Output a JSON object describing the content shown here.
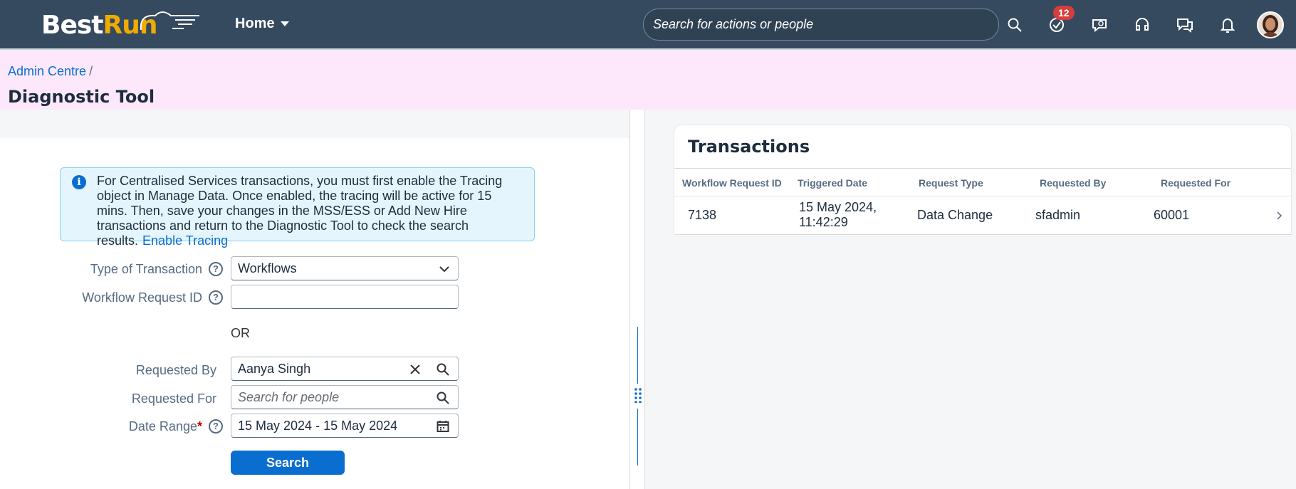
{
  "shell": {
    "logo_part1": "Best",
    "logo_part2": "Run",
    "home_label": "Home",
    "search_placeholder": "Search for actions or people",
    "notification_count": "12",
    "icons": [
      "search-icon",
      "todo-check-icon",
      "chat-icon",
      "headset-support-icon",
      "help-chat-icon",
      "bell-icon",
      "avatar"
    ]
  },
  "header": {
    "breadcrumb": "Admin Centre",
    "breadcrumb_sep": "/",
    "title": "Diagnostic Tool"
  },
  "info": {
    "text": "For Centralised Services transactions, you must first enable the Tracing object in Manage Data. Once enabled, the tracing will be active for 15 mins. Then, save your changes in the MSS/ESS or Add New Hire transactions and return to the Diagnostic Tool to check the search results.",
    "link": "Enable Tracing"
  },
  "form": {
    "type_label": "Type of Transaction",
    "type_value": "Workflows",
    "wf_id_label": "Workflow Request ID",
    "wf_id_value": "",
    "or_label": "OR",
    "requested_by_label": "Requested By",
    "requested_by_value": "Aanya Singh",
    "requested_for_label": "Requested For",
    "requested_for_placeholder": "Search for people",
    "date_label": "Date Range",
    "date_required": "*",
    "date_value": "15 May 2024 - 15 May 2024",
    "search_button": "Search"
  },
  "transactions": {
    "title": "Transactions",
    "columns": [
      "Workflow Request ID",
      "Triggered Date",
      "Request Type",
      "Requested By",
      "Requested For"
    ],
    "rows": [
      {
        "id": "7138",
        "date_line1": "15 May 2024,",
        "date_line2": "11:42:29",
        "type": "Data Change",
        "by": "sfadmin",
        "for": "60001"
      }
    ]
  },
  "colors": {
    "shell": "#354a5f",
    "accent": "#0a6ed1",
    "header_bg": "#fde8fb",
    "badge": "#d63d3d",
    "logo_accent": "#f0ab00"
  }
}
